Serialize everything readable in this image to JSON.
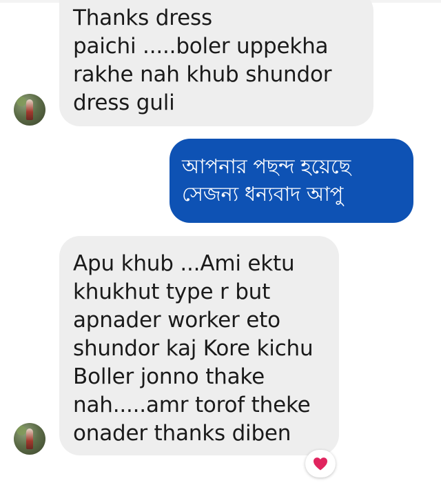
{
  "messages": [
    {
      "direction": "incoming",
      "lines": [
        "Thanks dress",
        "paichi .....boler uppekha",
        "rakhe nah khub shundor",
        "dress guli"
      ]
    },
    {
      "direction": "outgoing",
      "lines": [
        "আপনার পছন্দ হয়েছে",
        "সেজন্য ধন্যবাদ আপু"
      ]
    },
    {
      "direction": "incoming",
      "lines": [
        "Apu khub ...Ami ektu",
        "khukhut type r but",
        "apnader worker eto",
        "shundor kaj Kore kichu",
        "Boller jonno thake",
        "nah.....amr torof theke",
        "onader thanks diben"
      ]
    }
  ],
  "reaction": {
    "icon": "heart-icon",
    "color": "#e0245e"
  },
  "colors": {
    "incoming_bubble": "#eeeeee",
    "outgoing_bubble": "#0e52b4"
  }
}
